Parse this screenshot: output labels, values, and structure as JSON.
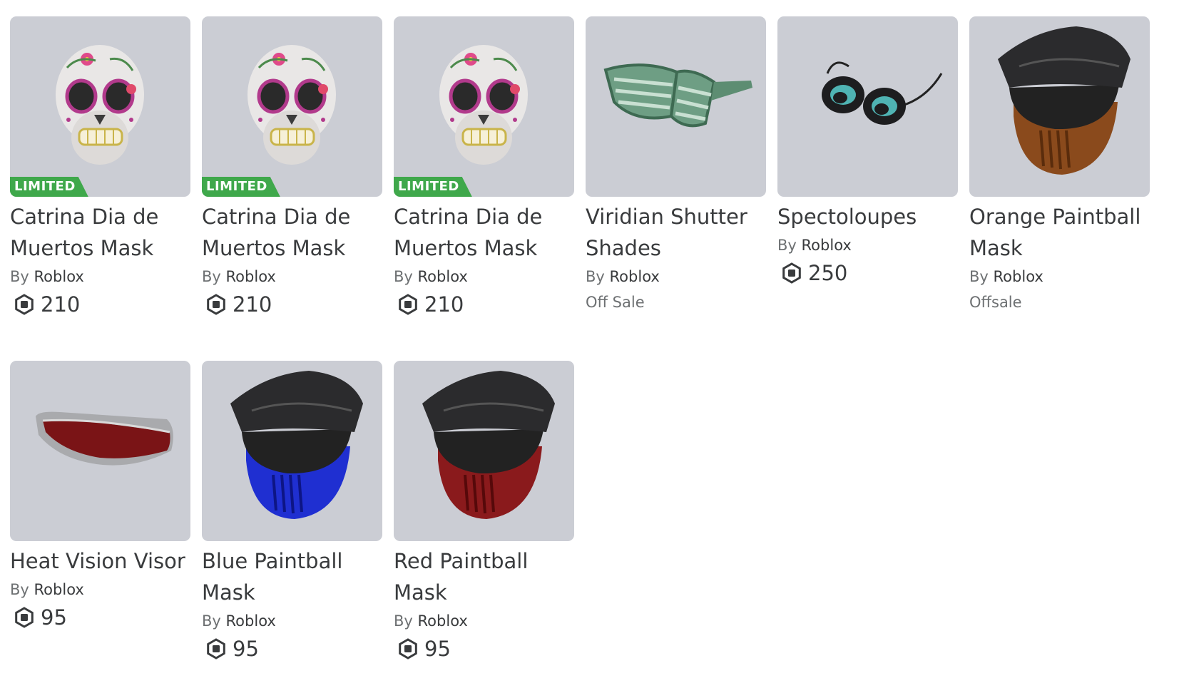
{
  "colors": {
    "tile_bg": "#cbcdd4",
    "limited_badge": "#3fa84b",
    "text": "#393b3d",
    "muted": "#6d7072"
  },
  "items": [
    {
      "name": "Catrina Dia de Muertos Mask",
      "by": "By",
      "creator": "Roblox",
      "limited": "LIMITED",
      "price": "210",
      "status": null,
      "icon": "sugar-skull-mask"
    },
    {
      "name": "Catrina Dia de Muertos Mask",
      "by": "By",
      "creator": "Roblox",
      "limited": "LIMITED",
      "price": "210",
      "status": null,
      "icon": "sugar-skull-mask"
    },
    {
      "name": "Catrina Dia de Muertos Mask",
      "by": "By",
      "creator": "Roblox",
      "limited": "LIMITED",
      "price": "210",
      "status": null,
      "icon": "sugar-skull-mask"
    },
    {
      "name": "Viridian Shutter Shades",
      "by": "By",
      "creator": "Roblox",
      "limited": null,
      "price": null,
      "status": "Off Sale",
      "icon": "shutter-shades"
    },
    {
      "name": "Spectoloupes",
      "by": "By",
      "creator": "Roblox",
      "limited": null,
      "price": "250",
      "status": null,
      "icon": "loupe-goggles"
    },
    {
      "name": "Orange Paintball Mask",
      "by": "By",
      "creator": "Roblox",
      "limited": null,
      "price": null,
      "status": "Offsale",
      "icon": "paintball-mask-orange"
    },
    {
      "name": "Heat Vision Visor",
      "by": "By",
      "creator": "Roblox",
      "limited": null,
      "price": "95",
      "status": null,
      "icon": "visor"
    },
    {
      "name": "Blue Paintball Mask",
      "by": "By",
      "creator": "Roblox",
      "limited": null,
      "price": "95",
      "status": null,
      "icon": "paintball-mask-blue"
    },
    {
      "name": "Red Paintball Mask",
      "by": "By",
      "creator": "Roblox",
      "limited": null,
      "price": "95",
      "status": null,
      "icon": "paintball-mask-red"
    }
  ]
}
